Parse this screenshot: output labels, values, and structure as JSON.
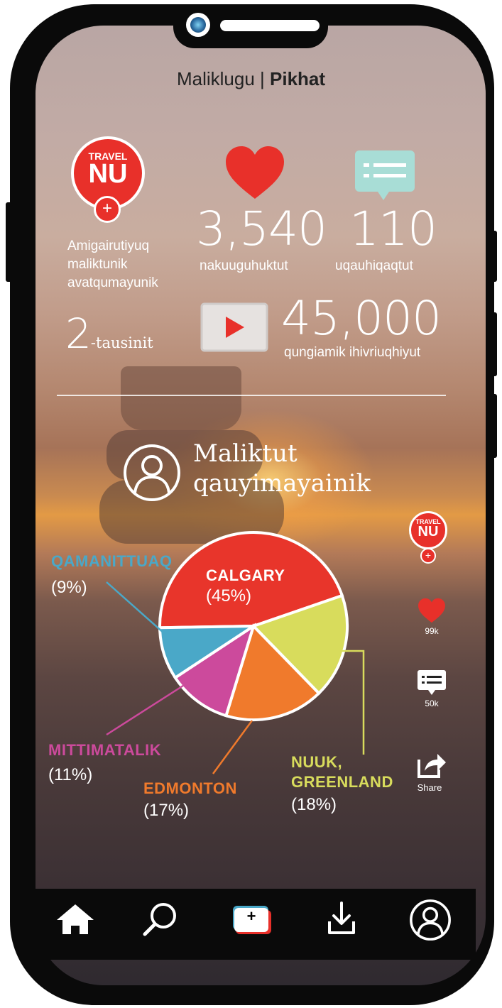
{
  "header": {
    "title_regular": "Maliklugu | ",
    "title_bold": "Pikhat"
  },
  "profile": {
    "logo_top": "TRAVEL",
    "logo_main": "NU",
    "plus": "+",
    "description_lines": [
      "Amigairutiyuq",
      "maliktunik",
      "avatqumayunik"
    ],
    "followers_value": "2",
    "followers_suffix": "-tausinit"
  },
  "stats": {
    "likes_value": "3,540",
    "likes_label": "nakuuguhuktut",
    "comments_value": "110",
    "comments_label": "uqauhiqaqtut",
    "views_value": "45,000",
    "views_label": "qungiamik ihivriuqhiyut"
  },
  "section": {
    "title_line1": "Maliktut",
    "title_line2": "qauyimayainik"
  },
  "chart_data": {
    "type": "pie",
    "series": [
      {
        "name": "CALGARY",
        "value": 45,
        "label": "(45%)",
        "color": "#e8352b"
      },
      {
        "name": "NUUK, GREENLAND",
        "value": 18,
        "label": "(18%)",
        "color": "#d8dc5c"
      },
      {
        "name": "EDMONTON",
        "value": 17,
        "label": "(17%)",
        "color": "#f07a2c"
      },
      {
        "name": "MITTIMATALIK",
        "value": 11,
        "label": "(11%)",
        "color": "#cc4a9c"
      },
      {
        "name": "QAMANITTUAQ",
        "value": 9,
        "label": "(9%)",
        "color": "#4aa8c8"
      }
    ],
    "labels": {
      "calgary": "CALGARY",
      "nuuk_1": "NUUK,",
      "nuuk_2": "GREENLAND",
      "edmonton": "EDMONTON",
      "mittimatalik": "MITTIMATALIK",
      "qamanittuaq": "QAMANITTUAQ"
    },
    "percents": {
      "calgary": "(45%)",
      "nuuk": "(18%)",
      "edmonton": "(17%)",
      "mittimatalik": "(11%)",
      "qamanittuaq": "(9%)"
    }
  },
  "side_actions": {
    "logo_top": "TRAVEL",
    "logo_main": "NU",
    "plus": "+",
    "likes_count": "99k",
    "comments_count": "50k",
    "share_label": "Share"
  },
  "colors": {
    "brand_red": "#e8302a",
    "comment_teal": "#a8ddd6"
  },
  "nav": {
    "create_plus": "+"
  }
}
